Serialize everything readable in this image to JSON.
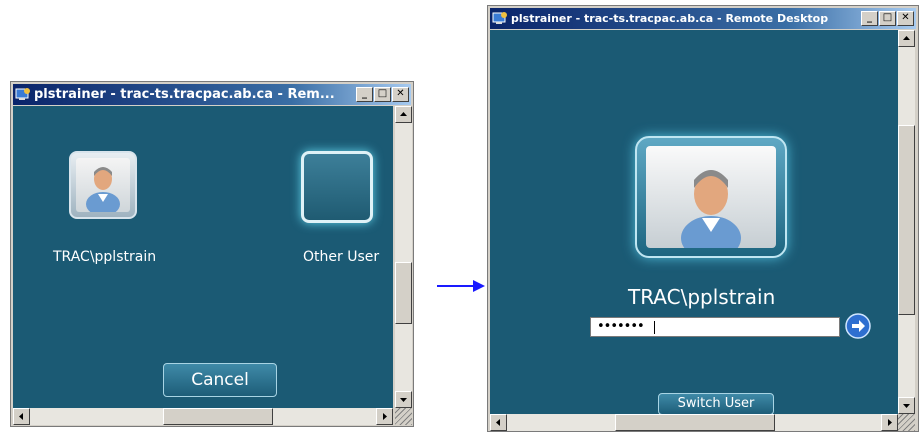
{
  "left_window": {
    "title": "plstrainer - trac-ts.tracpac.ab.ca - Rem...",
    "user_tile_label": "TRAC\\pplstrain",
    "other_user_label": "Other User",
    "cancel_label": "Cancel"
  },
  "right_window": {
    "title": "plstrainer - trac-ts.tracpac.ab.ca - Remote Desktop",
    "username": "TRAC\\pplstrain",
    "password_value": "•••••••",
    "switch_user_label": "Switch User"
  },
  "window_buttons": {
    "minimize": "_",
    "maximize": "□",
    "close": "✕"
  },
  "colors": {
    "desktop_bg": "#1b5a74",
    "arrow": "#1a1aff",
    "title_bar_start": "#0a246a",
    "title_bar_end": "#a6caf0"
  },
  "icons": [
    "remote-desktop-icon",
    "user-avatar-icon",
    "go-arrow-icon",
    "transition-arrow-icon"
  ]
}
